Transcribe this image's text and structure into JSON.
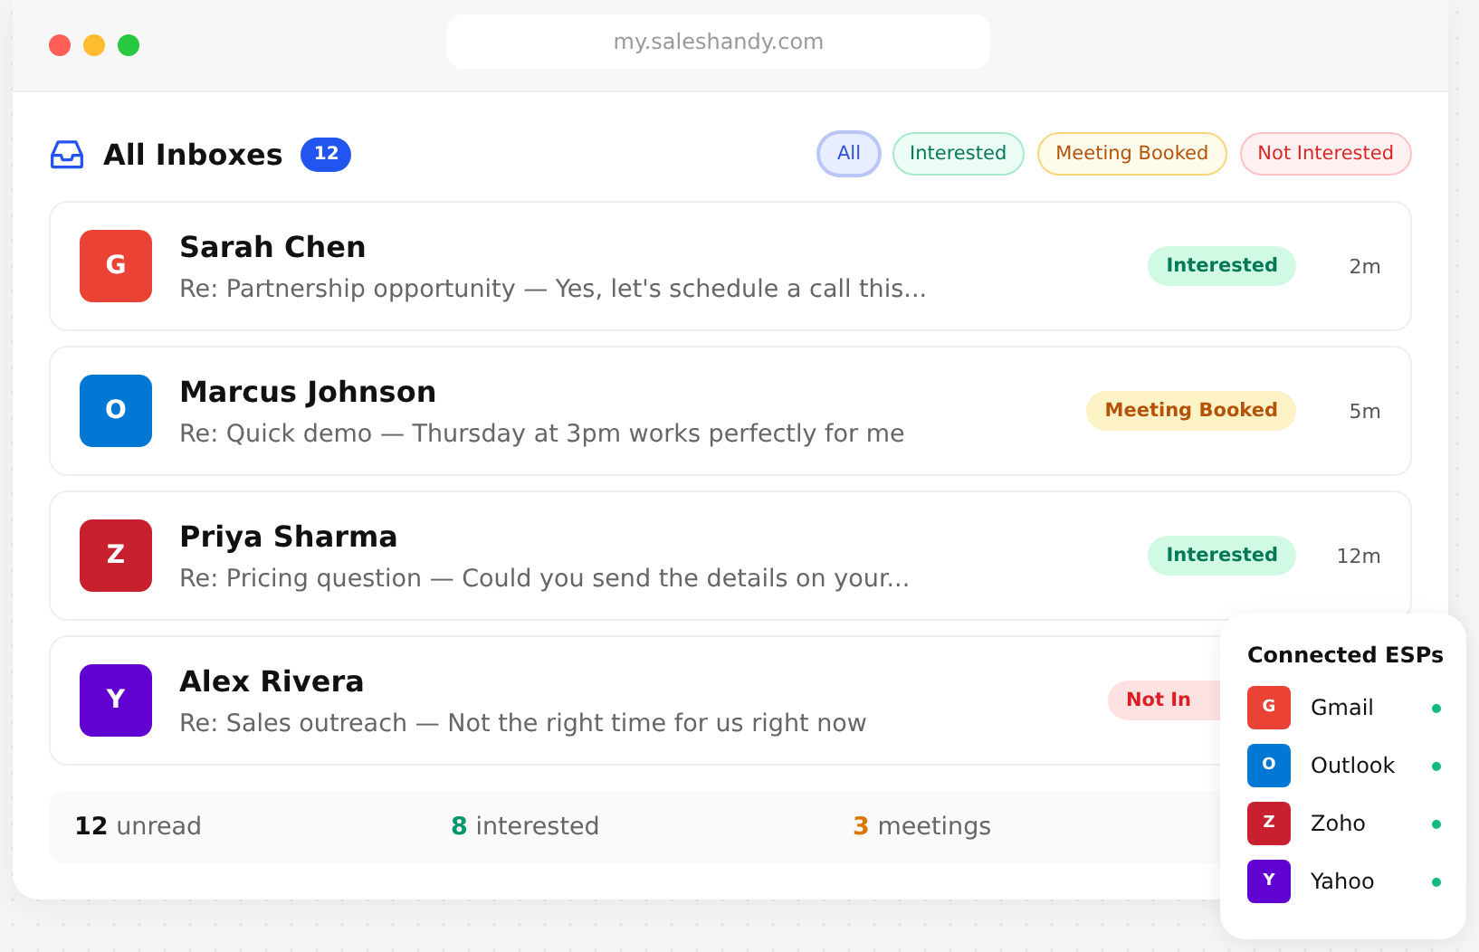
{
  "window": {
    "url": "my.saleshandy.com"
  },
  "header": {
    "title": "All Inboxes",
    "count": "12"
  },
  "filters": [
    {
      "label": "All",
      "kind": "all",
      "selected": true
    },
    {
      "label": "Interested",
      "kind": "interested",
      "selected": false
    },
    {
      "label": "Meeting Booked",
      "kind": "meeting",
      "selected": false
    },
    {
      "label": "Not Interested",
      "kind": "not_interested",
      "selected": false
    }
  ],
  "messages": [
    {
      "initial": "G",
      "color": "#ea4335",
      "name": "Sarah Chen",
      "preview": "Re: Partnership opportunity — Yes, let's schedule a call this...",
      "status": "Interested",
      "kind": "interested",
      "time": "2m"
    },
    {
      "initial": "O",
      "color": "#0078d4",
      "name": "Marcus Johnson",
      "preview": "Re: Quick demo — Thursday at 3pm works perfectly for me",
      "status": "Meeting Booked",
      "kind": "meeting",
      "time": "5m"
    },
    {
      "initial": "Z",
      "color": "#c8202f",
      "name": "Priya Sharma",
      "preview": "Re: Pricing question — Could you send the details on your...",
      "status": "Interested",
      "kind": "interested",
      "time": "12m"
    },
    {
      "initial": "Y",
      "color": "#6001d2",
      "name": "Alex Rivera",
      "preview": "Re: Sales outreach — Not the right time for us right now",
      "status": "Not In",
      "kind": "not_interested"
    }
  ],
  "stats": [
    {
      "value": "12",
      "label": "unread",
      "color": "#111111"
    },
    {
      "value": "8",
      "label": "interested",
      "color": "#059669"
    },
    {
      "value": "3",
      "label": "meetings",
      "color": "#d97706"
    }
  ],
  "esp_panel": {
    "title": "Connected ESPs",
    "items": [
      {
        "initial": "G",
        "color": "#ea4335",
        "name": "Gmail",
        "connected": true
      },
      {
        "initial": "O",
        "color": "#0078d4",
        "name": "Outlook",
        "connected": true
      },
      {
        "initial": "Z",
        "color": "#c8202f",
        "name": "Zoho",
        "connected": true
      },
      {
        "initial": "Y",
        "color": "#6001d2",
        "name": "Yahoo",
        "connected": true
      }
    ]
  }
}
